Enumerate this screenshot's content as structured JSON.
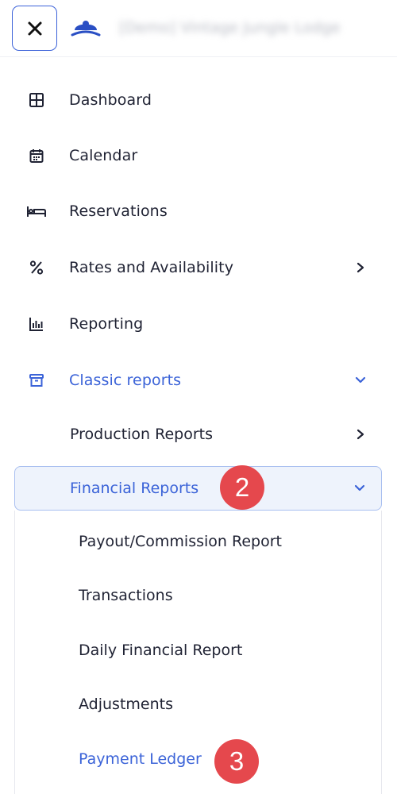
{
  "header": {
    "property_name": "[Demo] Vintage Jungle Lodge"
  },
  "nav": {
    "dashboard": "Dashboard",
    "calendar": "Calendar",
    "reservations": "Reservations",
    "rates": "Rates and Availability",
    "reporting": "Reporting",
    "classic_reports": "Classic reports"
  },
  "classic": {
    "production": "Production Reports",
    "financial": "Financial Reports"
  },
  "financial_items": {
    "payout": "Payout/Commission Report",
    "transactions": "Transactions",
    "daily": "Daily Financial Report",
    "adjustments": "Adjustments",
    "payment_ledger": "Payment Ledger"
  },
  "badges": {
    "step2": "2",
    "step3": "3"
  },
  "colors": {
    "accent": "#3b63d8",
    "badge": "#e5484d",
    "highlight_bg": "#eef3fc"
  }
}
